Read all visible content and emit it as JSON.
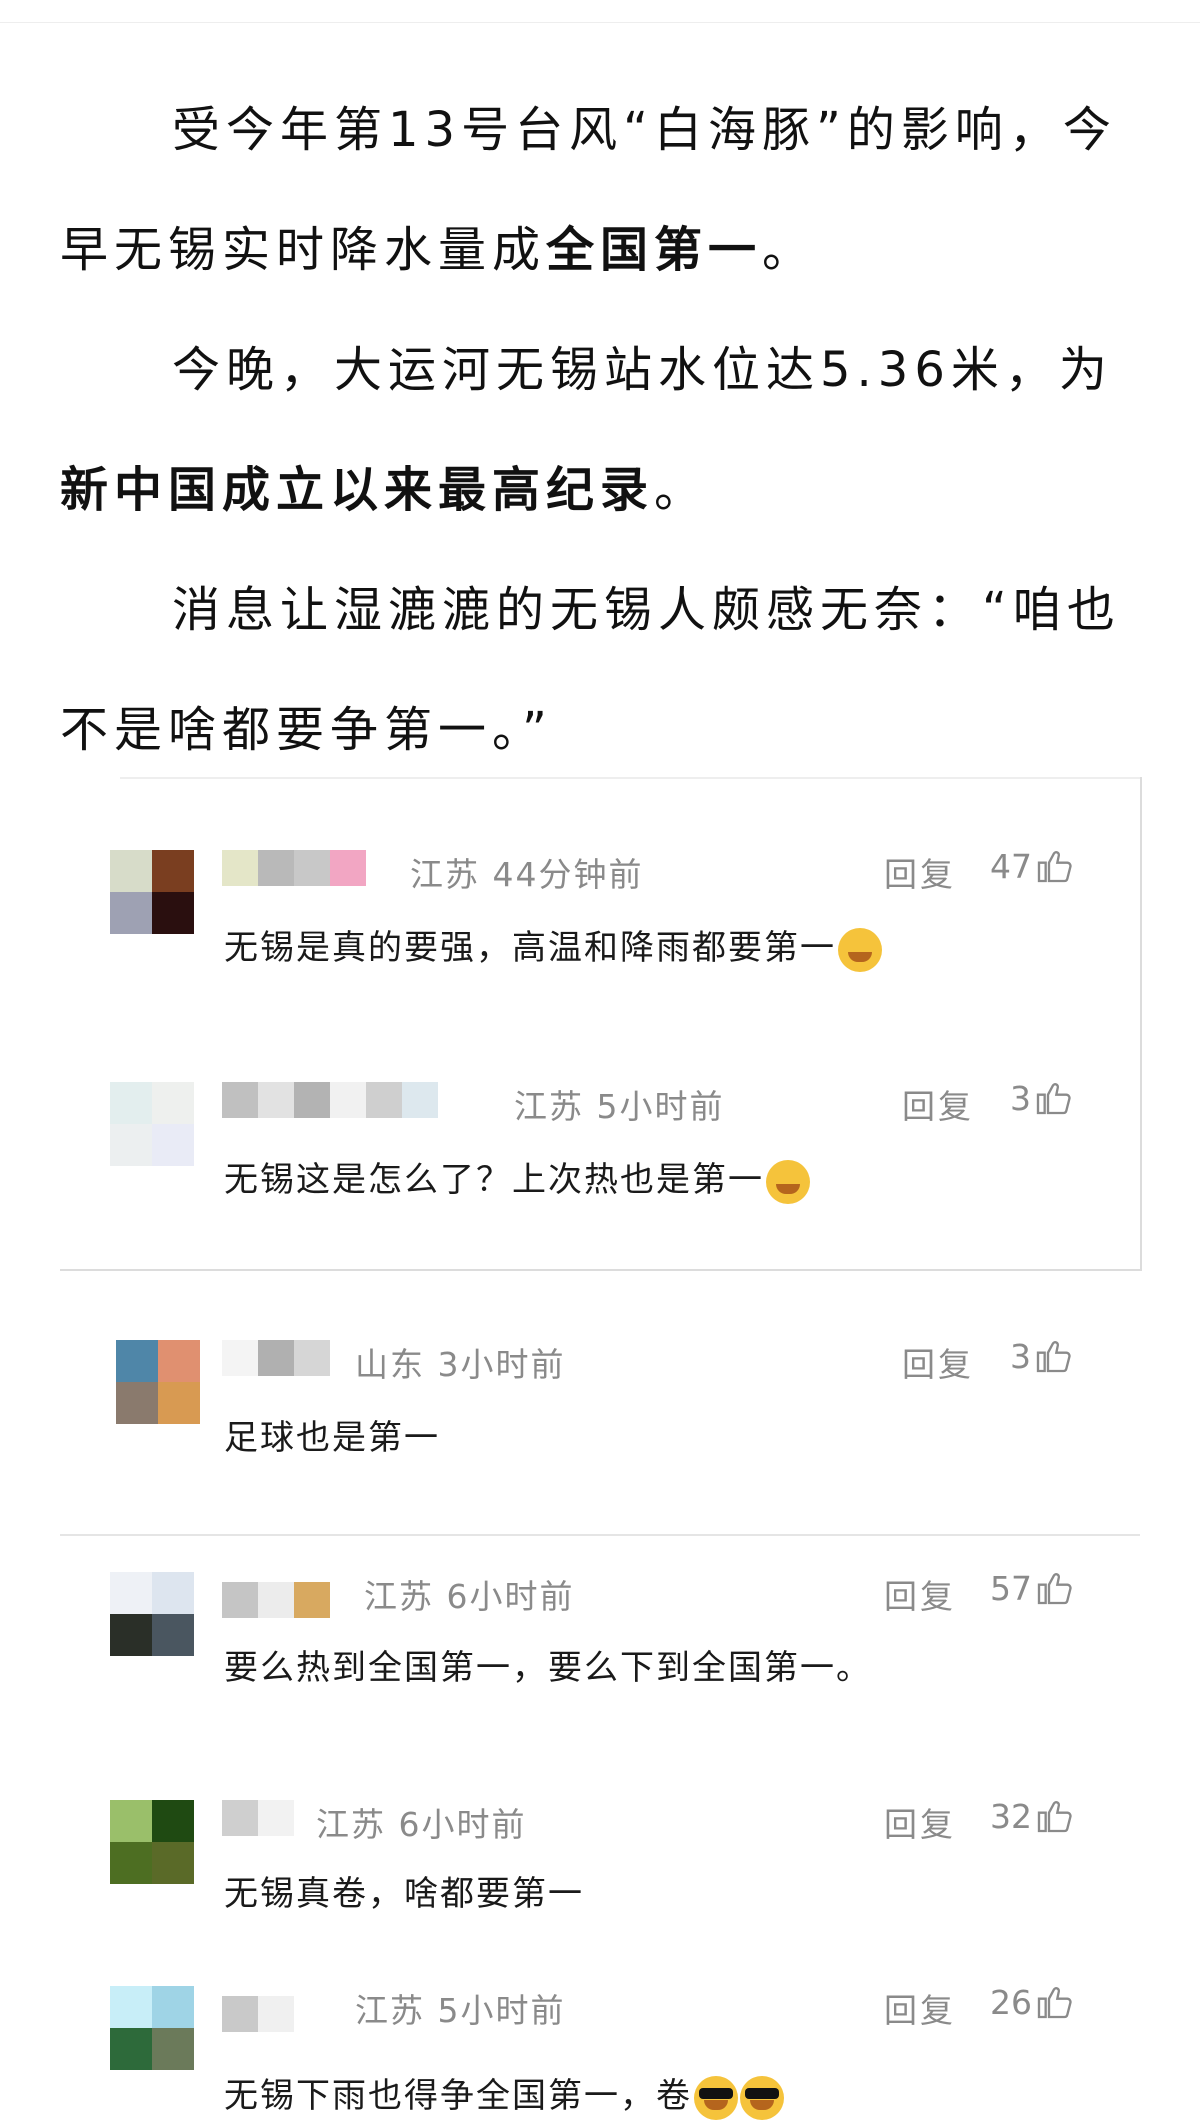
{
  "article": {
    "p1": {
      "a": "受今年第13号台风“白海豚”的影响，今早无锡实时降水量成",
      "b": "全国第一",
      "c": "。"
    },
    "p2": {
      "a": "今晚，大运河无锡站水位达5.36米，为",
      "b": "新中国成立以来最高纪录",
      "c": "。"
    },
    "p3": {
      "a": "消息让湿漉漉的无锡人颇感无奈：“咱也不是啥都要争第一。”"
    }
  },
  "reply_label": "回复",
  "replies": [
    {
      "meta": "江苏 44分钟前",
      "likes": "47",
      "text": "无锡是真的要强，高温和降雨都要第一",
      "emoji": "facepalm"
    },
    {
      "meta": "江苏 5小时前",
      "likes": "3",
      "text": "无锡这是怎么了？上次热也是第一",
      "emoji": "facepalm"
    }
  ],
  "comments": [
    {
      "meta": "山东 3小时前",
      "likes": "3",
      "text": "足球也是第一"
    },
    {
      "meta": "江苏 6小时前",
      "likes": "57",
      "text": "要么热到全国第一，要么下到全国第一。"
    },
    {
      "meta": "江苏 6小时前",
      "likes": "32",
      "text": "无锡真卷，啥都要第一"
    },
    {
      "meta": "江苏 5小时前",
      "likes": "26",
      "text": "无锡下雨也得争全国第一，卷",
      "emoji": "cool"
    }
  ],
  "icons": {
    "like": "thumbs-up-icon"
  },
  "colors": {
    "meta": "#8a8a8a",
    "text": "#1a1a1a"
  }
}
